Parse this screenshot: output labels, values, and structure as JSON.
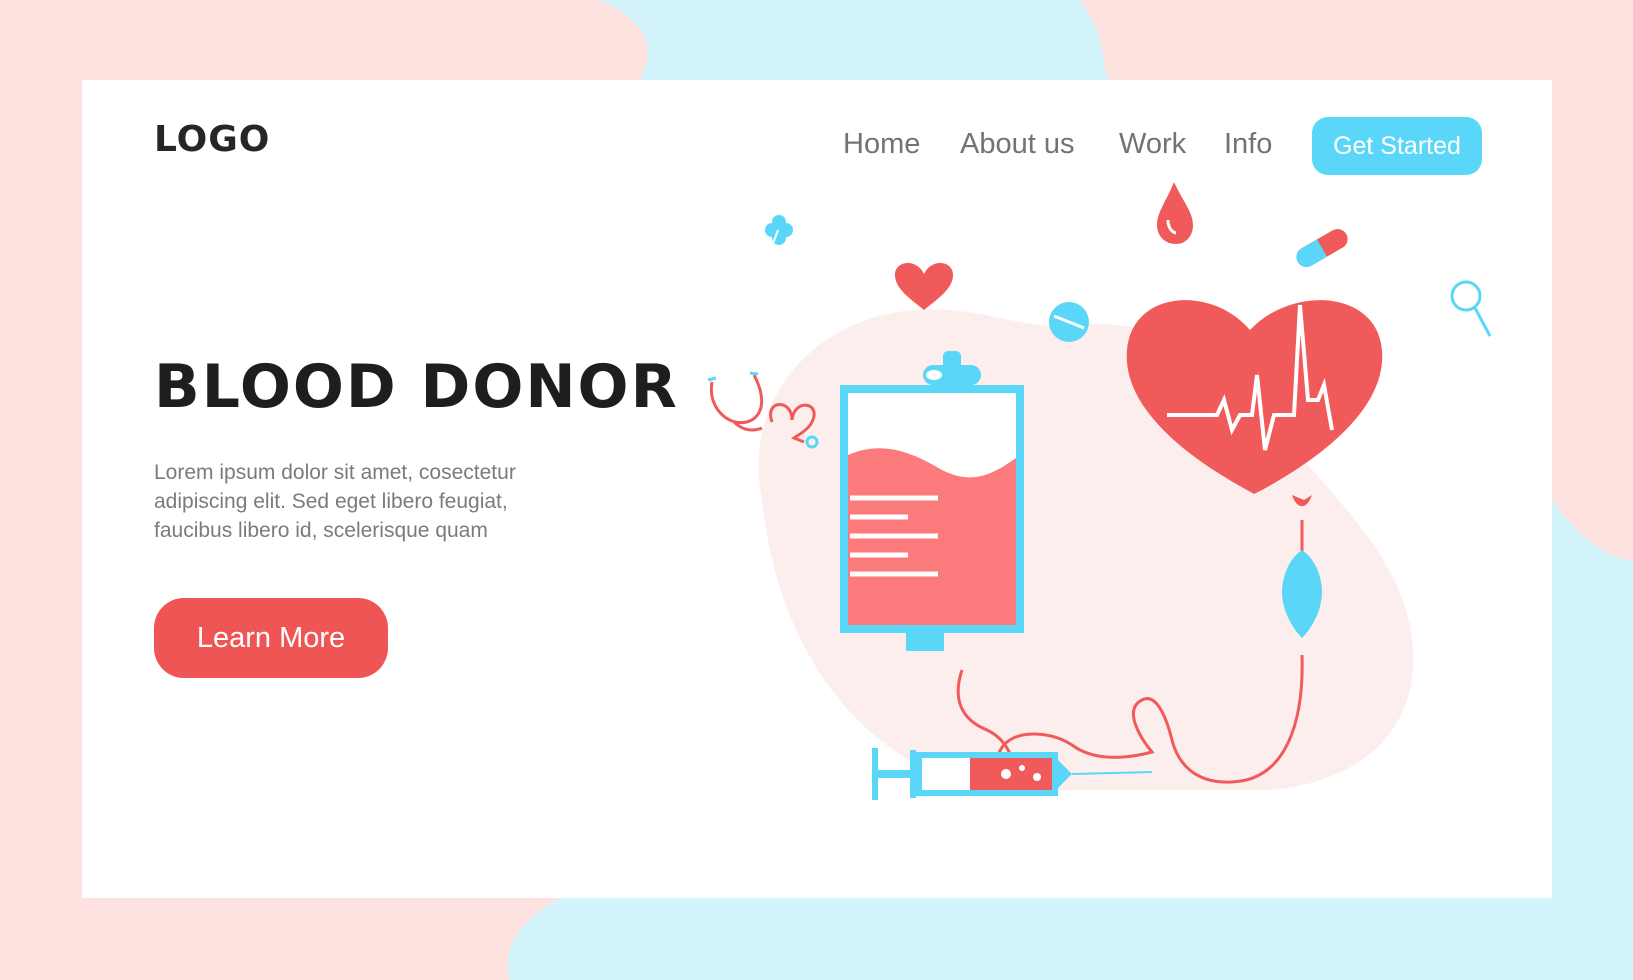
{
  "logo": {
    "text": "LOGO"
  },
  "nav": {
    "items": [
      {
        "label": "Home"
      },
      {
        "label": "About us"
      },
      {
        "label": "Work"
      },
      {
        "label": "Info"
      }
    ],
    "cta_label": "Get Started"
  },
  "hero": {
    "title": "BLOOD DONOR",
    "paragraph_lines": [
      "Lorem ipsum dolor sit amet, cosectetur",
      "adipiscing elit. Sed eget libero feugiat,",
      "faucibus libero id, scelerisque quam"
    ],
    "button_label": "Learn More"
  },
  "illustration": {
    "icons": [
      "blood-bag-icon",
      "heart-with-pulse-icon",
      "syringe-icon",
      "stethoscope-icon",
      "blood-drop-icon",
      "small-heart-icon",
      "pill-capsule-icon",
      "round-pill-icon",
      "magnifier-icon",
      "medical-cross-icon"
    ]
  },
  "colors": {
    "page_background": "#fde2df",
    "background_blob": "#d4f4fc",
    "card_background": "#ffffff",
    "accent_red": "#f05556",
    "accent_blue": "#5ad7f8",
    "blood_red": "#f05a5a",
    "heading_text": "#1e1e1e",
    "nav_text": "#737373",
    "body_text": "#7b7b7b"
  }
}
